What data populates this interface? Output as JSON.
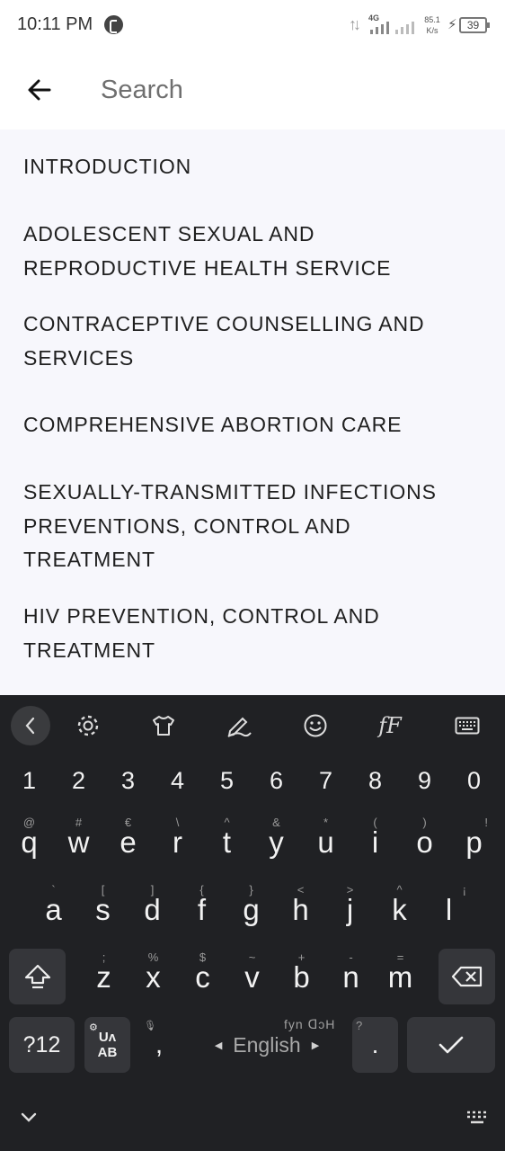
{
  "status_bar": {
    "time": "10:11 PM",
    "network": "4G",
    "speed_value": "85.1",
    "speed_unit": "K/s",
    "battery": "39"
  },
  "header": {
    "search_placeholder": "Search"
  },
  "results": [
    "INTRODUCTION",
    "ADOLESCENT SEXUAL AND REPRODUCTIVE HEALTH SERVICE",
    "CONTRACEPTIVE COUNSELLING AND SERVICES",
    "COMPREHENSIVE ABORTION CARE",
    "SEXUALLY-TRANSMITTED INFECTIONS PREVENTIONS, CONTROL AND TREATMENT",
    "HIV PREVENTION, CONTROL AND TREATMENT"
  ],
  "keyboard": {
    "toolbar_icons": [
      "collapse-chevron-icon",
      "settings-icon",
      "theme-shirt-icon",
      "handwriting-icon",
      "emoji-icon",
      "font-icon",
      "keyboard-layout-icon"
    ],
    "font_label": "fF",
    "numbers": [
      "1",
      "2",
      "3",
      "4",
      "5",
      "6",
      "7",
      "8",
      "9",
      "0"
    ],
    "row1": [
      {
        "key": "q",
        "hint": "@"
      },
      {
        "key": "w",
        "hint": "#"
      },
      {
        "key": "e",
        "hint": "€"
      },
      {
        "key": "r",
        "hint": "\\"
      },
      {
        "key": "t",
        "hint": "^"
      },
      {
        "key": "y",
        "hint": "&"
      },
      {
        "key": "u",
        "hint": "*"
      },
      {
        "key": "i",
        "hint": "("
      },
      {
        "key": "o",
        "hint": ")"
      },
      {
        "key": "p",
        "hint": "!"
      }
    ],
    "row2": [
      {
        "key": "a",
        "hint": "`"
      },
      {
        "key": "s",
        "hint": "["
      },
      {
        "key": "d",
        "hint": "]"
      },
      {
        "key": "f",
        "hint": "{"
      },
      {
        "key": "g",
        "hint": "}"
      },
      {
        "key": "h",
        "hint": "<"
      },
      {
        "key": "j",
        "hint": ">"
      },
      {
        "key": "k",
        "hint": "^"
      },
      {
        "key": "l",
        "hint": "¡"
      }
    ],
    "row3": [
      {
        "key": "z",
        "hint": ";"
      },
      {
        "key": "x",
        "hint": "%"
      },
      {
        "key": "c",
        "hint": "$"
      },
      {
        "key": "v",
        "hint": "~"
      },
      {
        "key": "b",
        "hint": "+"
      },
      {
        "key": "n",
        "hint": "-"
      },
      {
        "key": "m",
        "hint": "="
      }
    ],
    "symbols_label": "?12",
    "lang_switch_top": "Uʌ",
    "lang_switch_bottom": "AB",
    "comma": ",",
    "space_label": "English",
    "space_hint": "fyn ᗡɔH",
    "period": ".",
    "period_hint": "?"
  }
}
